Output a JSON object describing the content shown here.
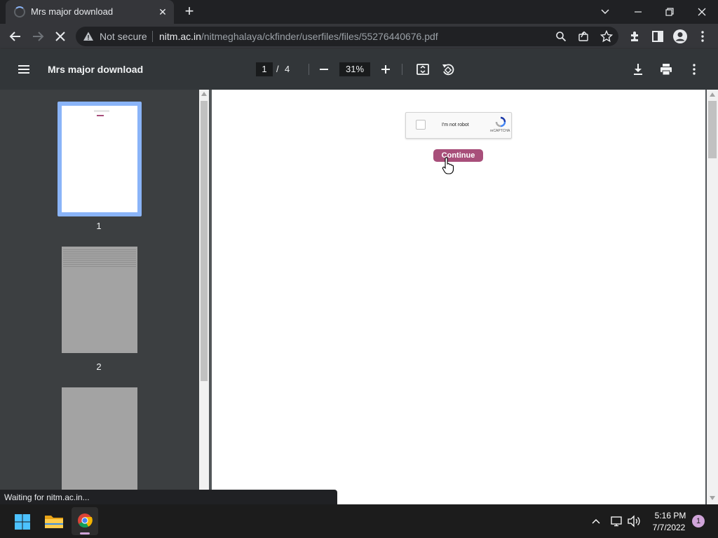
{
  "browser": {
    "tab_title": "Mrs major download",
    "not_secure_label": "Not secure",
    "url_host": "nitm.ac.in",
    "url_path": "/nitmeghalaya/ckfinder/userfiles/files/55276440676.pdf"
  },
  "pdf": {
    "title": "Mrs major download",
    "current_page": "1",
    "page_separator": "/",
    "total_pages": "4",
    "zoom": "31%",
    "thumbnails": [
      {
        "label": "1"
      },
      {
        "label": "2"
      }
    ]
  },
  "document": {
    "captcha_label": "I'm not robot",
    "captcha_brand": "reCAPTCHA",
    "continue_label": "Continue"
  },
  "status_text": "Waiting for nitm.ac.in...",
  "taskbar": {
    "time": "5:16 PM",
    "date": "7/7/2022",
    "notification_count": "1"
  },
  "colors": {
    "continue_button": "#a84f7a",
    "thumb_selected_border": "#8ab4f8",
    "viewer_background": "#525659"
  }
}
